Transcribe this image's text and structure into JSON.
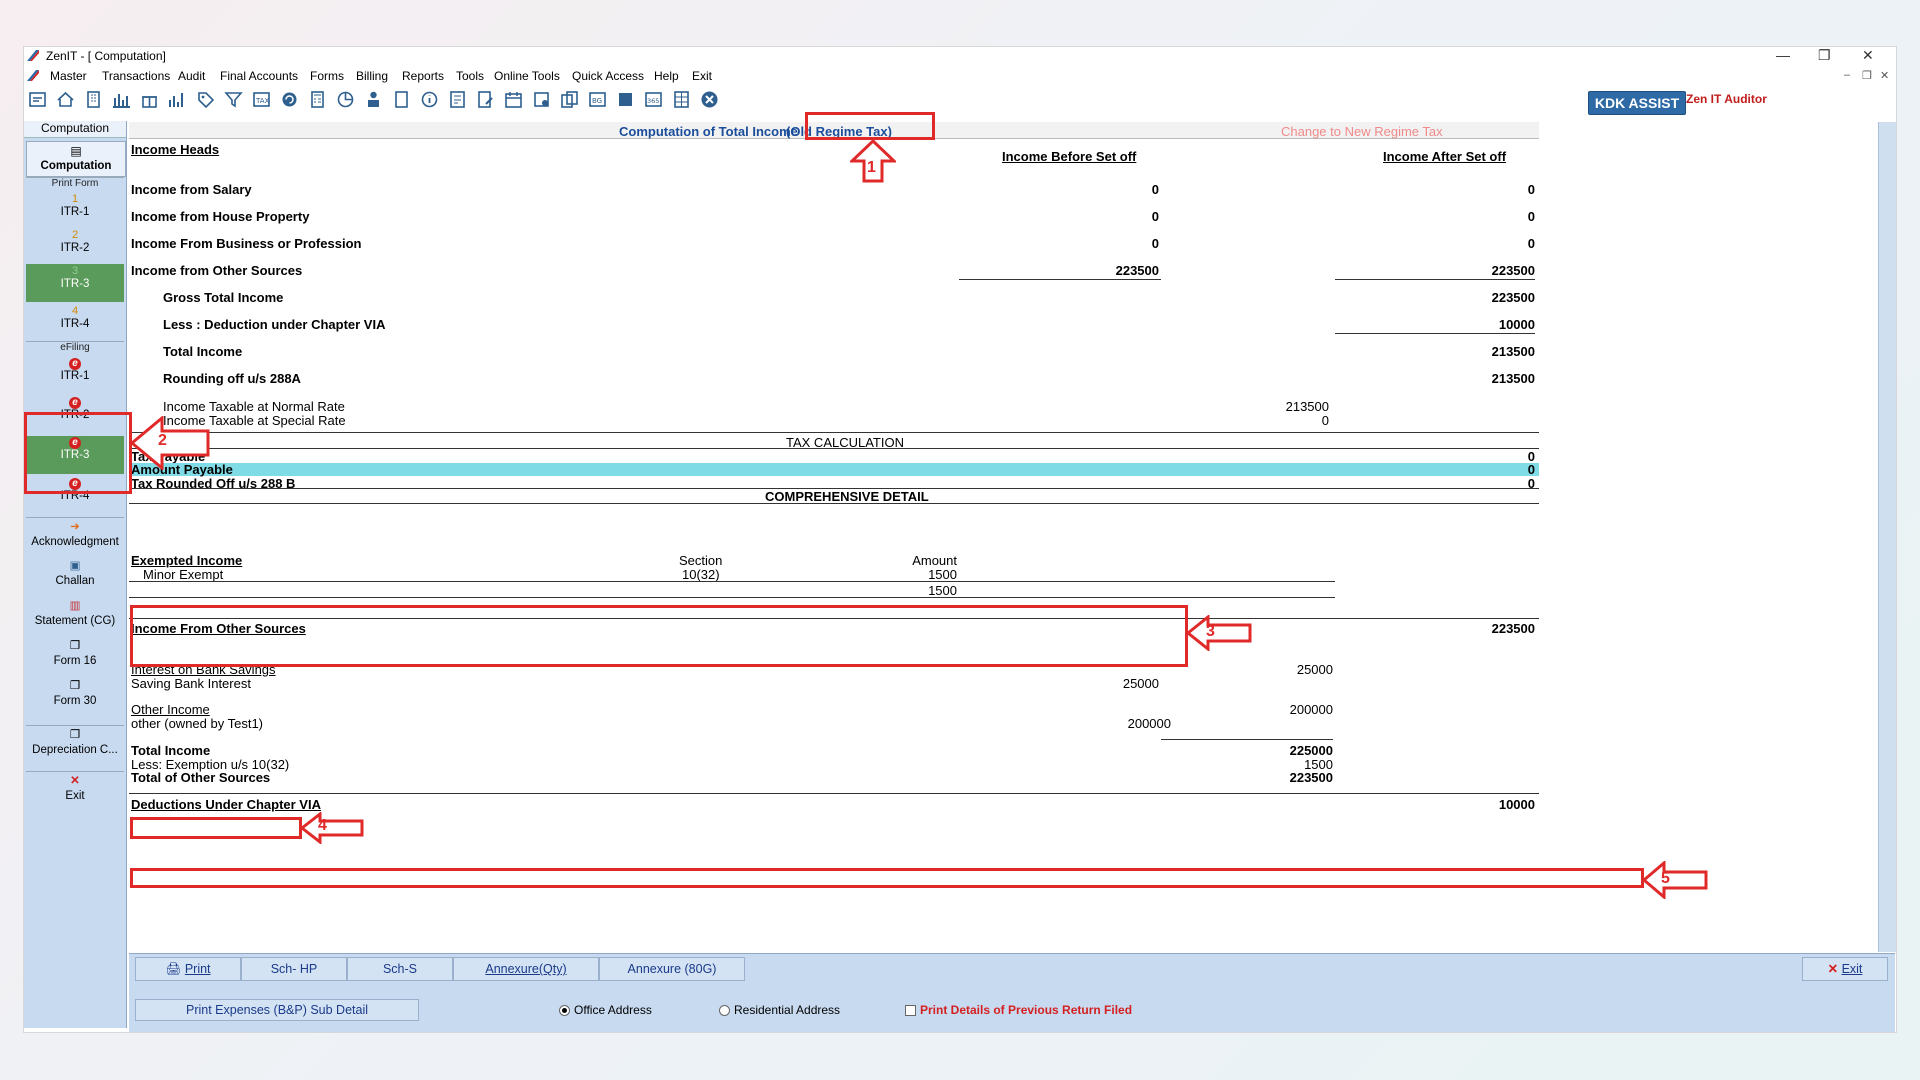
{
  "window": {
    "title": "ZenIT - [ Computation]",
    "minimize": "—",
    "restore": "❐",
    "close": "✕"
  },
  "menu": [
    "Master",
    "Transactions",
    "Audit",
    "Final Accounts",
    "Forms",
    "Billing",
    "Reports",
    "Tools",
    "Online Tools",
    "Quick Access",
    "Help",
    "Exit"
  ],
  "brand": {
    "assist": "KDK ASSIST",
    "auditor": "Zen IT Auditor"
  },
  "sidebar": {
    "tab": "Computation",
    "computation": "Computation",
    "print_form": "Print Form",
    "print_items": [
      {
        "num": "1",
        "label": "ITR-1"
      },
      {
        "num": "2",
        "label": "ITR-2"
      },
      {
        "num": "3",
        "label": "ITR-3"
      },
      {
        "num": "4",
        "label": "ITR-4"
      }
    ],
    "efiling": "eFiling",
    "efiling_items": [
      {
        "icon": "e",
        "label": "ITR-1"
      },
      {
        "icon": "e",
        "label": "ITR-2"
      },
      {
        "icon": "e",
        "label": "ITR-3"
      },
      {
        "icon": "e",
        "label": "ITR-4"
      }
    ],
    "acknowledgment": "Acknowledgment",
    "challan": "Challan",
    "statement_cg": "Statement (CG)",
    "form16": "Form 16",
    "form30": "Form 30",
    "depreciation": "Depreciation C...",
    "exit": "Exit"
  },
  "header": {
    "title": "Computation of Total Income",
    "regime": "(Old Regime Tax)",
    "change_link": "Change to New Regime Tax"
  },
  "columns": {
    "heads": "Income Heads",
    "before": "Income Before Set off",
    "after": "Income After Set off"
  },
  "heads": [
    {
      "label": "Income from Salary",
      "before": "0",
      "after": "0"
    },
    {
      "label": "Income from House Property",
      "before": "0",
      "after": "0"
    },
    {
      "label": "Income From Business or Profession",
      "before": "0",
      "after": "0"
    },
    {
      "label": "Income from Other Sources",
      "before": "223500",
      "after": "223500"
    }
  ],
  "totals": {
    "gross_label": "Gross Total Income",
    "gross": "223500",
    "deduction_label": "Less : Deduction under Chapter VIA",
    "deduction": "10000",
    "total_label": "Total Income",
    "total": "213500",
    "rounding_label": "Rounding off u/s 288A",
    "rounding": "213500",
    "normal_label": "Income Taxable at Normal Rate",
    "normal": "213500",
    "special_label": "Income Taxable at Special Rate",
    "special": "0"
  },
  "tax": {
    "section_title": "TAX CALCULATION",
    "payable_label": "Tax Payable",
    "payable": "0",
    "amount_label": "Amount Payable",
    "amount": "0",
    "rounded_label": "Tax Rounded Off u/s 288 B",
    "rounded": "0"
  },
  "comprehensive": "COMPREHENSIVE DETAIL",
  "exempted": {
    "title": "Exempted Income",
    "section_h": "Section",
    "amount_h": "Amount",
    "row_label": "Minor Exempt",
    "row_section": "10(32)",
    "row_amount": "1500",
    "total": "1500"
  },
  "other_sources": {
    "title": "Income From Other Sources",
    "total": "223500",
    "interest_title": "Interest on Bank Savings",
    "interest_total": "25000",
    "sb_label": "Saving Bank Interest",
    "sb_value": "25000",
    "other_title": "Other Income",
    "other_total": "200000",
    "other_label": "other (owned by Test1)",
    "other_value": "200000",
    "total_income_label": "Total Income",
    "total_income": "225000",
    "exemption_label": "Less: Exemption u/s 10(32)",
    "exemption": "1500",
    "total_other_label": "Total of Other Sources",
    "total_other": "223500"
  },
  "deductions": {
    "title": "Deductions Under Chapter VIA",
    "value": "10000"
  },
  "callouts": [
    "1",
    "2",
    "3",
    "4",
    "5"
  ],
  "bottom": {
    "print": "Print",
    "sch_hp": "Sch- HP",
    "sch_s": "Sch-S",
    "annex_qty": "Annexure(Qty)",
    "annex_80g": "Annexure (80G)",
    "exit": "Exit",
    "print_expenses": "Print Expenses (B&P) Sub Detail",
    "office": "Office Address",
    "residential": "Residential Address",
    "prev_return": "Print Details of Previous Return Filed"
  }
}
